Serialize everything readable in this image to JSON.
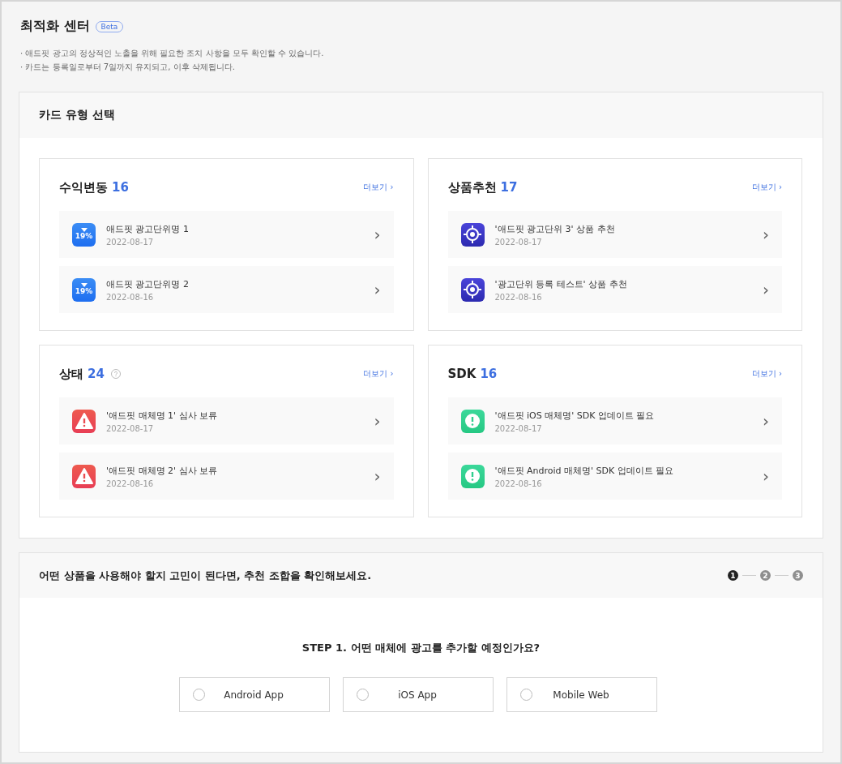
{
  "page": {
    "title": "최적화 센터",
    "badge": "Beta",
    "notes": [
      "· 애드핏 광고의 정상적인 노출을 위해 필요한 조치 사항을 모두 확인할 수 있습니다.",
      "· 카드는 등록일로부터 7일까지 유지되고, 이후 삭제됩니다."
    ]
  },
  "card_section": {
    "title": "카드 유형 선택",
    "cards": [
      {
        "title": "수익변동",
        "count": "16",
        "help": false,
        "more": "더보기 ›",
        "items": [
          {
            "kind": "drop",
            "icon_text": "19%",
            "title": "애드핏 광고단위명 1",
            "date": "2022-08-17",
            "chevron": "›"
          },
          {
            "kind": "drop",
            "icon_text": "19%",
            "title": "애드핏 광고단위명 2",
            "date": "2022-08-16",
            "chevron": "›"
          }
        ]
      },
      {
        "title": "상품추천",
        "count": "17",
        "help": false,
        "more": "더보기 ›",
        "items": [
          {
            "kind": "target",
            "title": "'애드핏 광고단위 3' 상품 추천",
            "date": "2022-08-17",
            "chevron": "›"
          },
          {
            "kind": "target",
            "title": "'광고단위 등록 테스트' 상품 추천",
            "date": "2022-08-16",
            "chevron": "›"
          }
        ]
      },
      {
        "title": "상태",
        "count": "24",
        "help": true,
        "more": "더보기 ›",
        "items": [
          {
            "kind": "warning",
            "title": "'애드핏 매체명 1' 심사 보류",
            "date": "2022-08-17",
            "chevron": "›"
          },
          {
            "kind": "warning",
            "title": "'애드핏 매체명 2' 심사 보류",
            "date": "2022-08-16",
            "chevron": "›"
          }
        ]
      },
      {
        "title": "SDK",
        "count": "16",
        "help": false,
        "more": "더보기 ›",
        "items": [
          {
            "kind": "notice",
            "title": "'애드핏 iOS 매체명' SDK 업데이트 필요",
            "date": "2022-08-17",
            "chevron": "›"
          },
          {
            "kind": "notice",
            "title": "'애드핏 Android 매체명' SDK 업데이트 필요",
            "date": "2022-08-16",
            "chevron": "›"
          }
        ]
      }
    ]
  },
  "recommend": {
    "title": "어떤 상품을 사용해야 할지 고민이 된다면, 추천 조합을 확인해보세요.",
    "steps": [
      {
        "label": "1",
        "selected": true
      },
      {
        "label": "2",
        "selected": false
      },
      {
        "label": "3",
        "selected": false
      }
    ],
    "question": "STEP 1. 어떤 매체에 광고를 추가할 예정인가요?",
    "options": [
      {
        "label": "Android App",
        "selected": false
      },
      {
        "label": "iOS App",
        "selected": false
      },
      {
        "label": "Mobile Web",
        "selected": false
      }
    ]
  }
}
